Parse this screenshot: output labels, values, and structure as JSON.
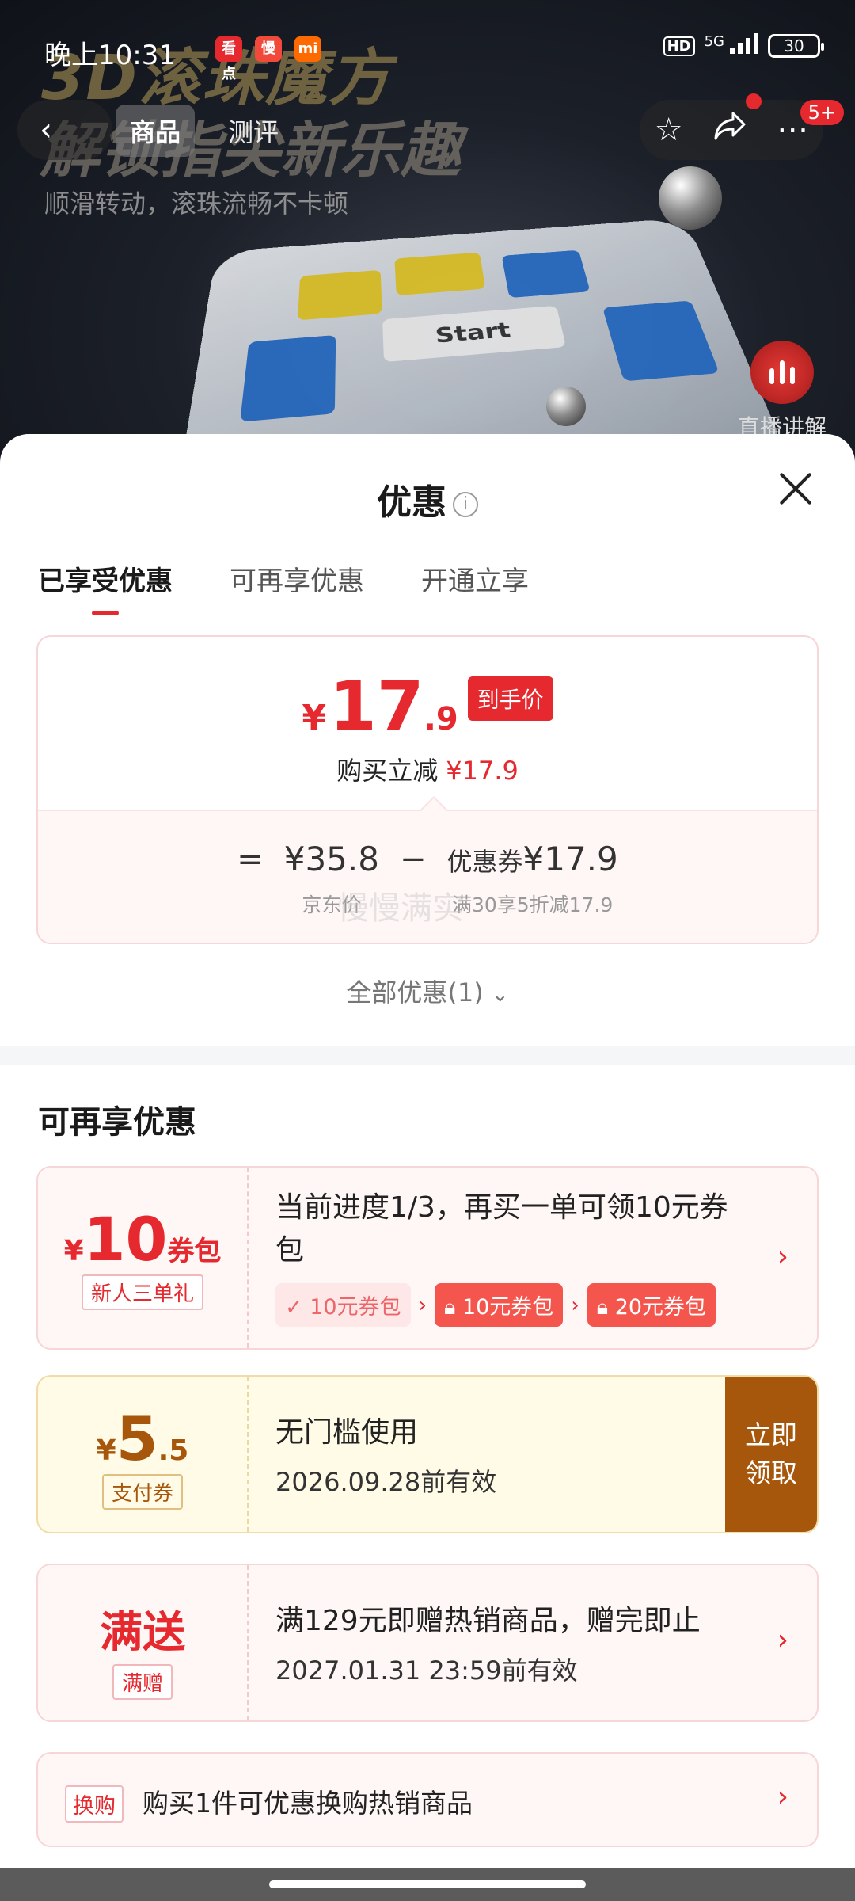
{
  "status_bar": {
    "time": "晚上10:31",
    "apps": [
      "看点",
      "慢",
      "mi"
    ],
    "hd": "HD",
    "network": "5G",
    "battery": "30"
  },
  "hero": {
    "line1": "3D滚珠魔方",
    "line2": "解锁指尖新乐趣",
    "subtitle": "顺滑转动，滚珠流畅不卡顿",
    "cube_label": "Start"
  },
  "top_nav": {
    "back_icon": "chevron-left",
    "tabs": [
      "商品",
      "测评"
    ],
    "actions": [
      "star-icon",
      "share-icon",
      "more-icon"
    ],
    "message_badge": "5+"
  },
  "live": {
    "label": "直播讲解"
  },
  "sheet": {
    "title": "优惠",
    "tabs": [
      "已享受优惠",
      "可再享优惠",
      "开通立享"
    ],
    "price": {
      "currency": "¥",
      "integer": "17",
      "decimal": ".9",
      "tag": "到手价",
      "discount_text": "购买立减",
      "discount_value": "¥17.9"
    },
    "formula": {
      "equals": "=",
      "base_value": "¥35.8",
      "base_label": "京东价",
      "minus": "−",
      "coupon_prefix": "优惠券",
      "coupon_value": "¥17.9",
      "coupon_label": "满30享5折减17.9"
    },
    "watermark": "慢慢满实",
    "all_deals": "全部优惠(1)"
  },
  "more_deals": {
    "title": "可再享优惠",
    "cards": [
      {
        "amount_currency": "¥",
        "amount": "10",
        "amount_unit": "券包",
        "badge": "新人三单礼",
        "title": "当前进度1/3，再买一单可领10元券包",
        "steps": [
          "10元券包",
          "10元券包",
          "20元券包"
        ]
      },
      {
        "amount_currency": "¥",
        "amount": "5",
        "amount_decimal": ".5",
        "badge": "支付券",
        "title": "无门槛使用",
        "subtitle": "2026.09.28前有效",
        "button": "立即领取"
      },
      {
        "headline": "满送",
        "badge": "满赠",
        "title": "满129元即赠热销商品，赠完即止",
        "subtitle": "2027.01.31 23:59前有效"
      }
    ],
    "swap": {
      "badge": "换购",
      "text": "购买1件可优惠换购热销商品"
    }
  },
  "colors": {
    "accent": "#e5292e",
    "claim_button": "#a6570b",
    "card_bg": "#fff6f6"
  }
}
